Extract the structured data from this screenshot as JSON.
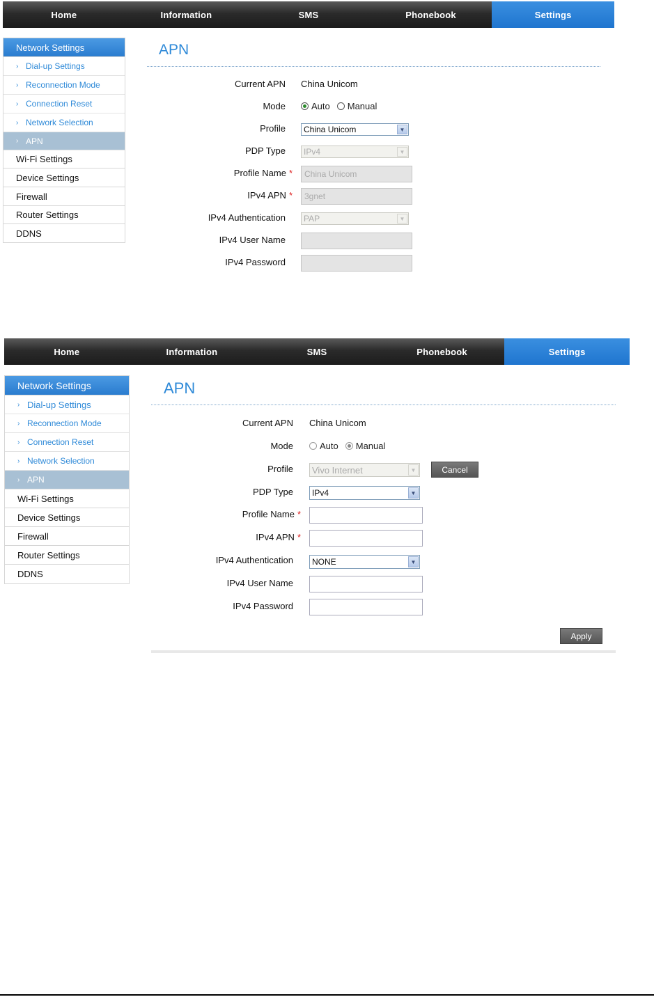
{
  "nav": {
    "tabs": [
      "Home",
      "Information",
      "SMS",
      "Phonebook",
      "Settings"
    ],
    "active": "Settings"
  },
  "sidebar": {
    "header": "Network Settings",
    "subitems": [
      "Dial-up Settings",
      "Reconnection Mode",
      "Connection Reset",
      "Network Selection",
      "APN"
    ],
    "selected": "APN",
    "items": [
      "Wi-Fi Settings",
      "Device Settings",
      "Firewall",
      "Router Settings",
      "DDNS"
    ]
  },
  "screen1": {
    "title": "APN",
    "labels": {
      "current_apn": "Current APN",
      "mode": "Mode",
      "profile": "Profile",
      "pdp_type": "PDP Type",
      "profile_name": "Profile Name",
      "ipv4_apn": "IPv4 APN",
      "ipv4_auth": "IPv4 Authentication",
      "ipv4_user": "IPv4 User Name",
      "ipv4_pass": "IPv4 Password"
    },
    "required_mark": "*",
    "current_apn_value": "China Unicom",
    "mode_options": [
      "Auto",
      "Manual"
    ],
    "mode_selected": "Auto",
    "profile_value": "China Unicom",
    "pdp_type_value": "IPv4",
    "profile_name_value": "China Unicom",
    "ipv4_apn_value": "3gnet",
    "ipv4_auth_value": "PAP",
    "ipv4_user_value": "",
    "ipv4_pass_value": ""
  },
  "screen2": {
    "title": "APN",
    "current_apn_value": "China Unicom",
    "mode_options": [
      "Auto",
      "Manual"
    ],
    "mode_selected": "Manual",
    "profile_value": "Vivo Internet",
    "cancel_label": "Cancel",
    "pdp_type_value": "IPv4",
    "profile_name_value": "",
    "ipv4_apn_value": "",
    "ipv4_auth_value": "NONE",
    "ipv4_user_value": "",
    "ipv4_pass_value": "",
    "apply_label": "Apply"
  },
  "colors": {
    "accent": "#2a7ccf",
    "nav_bg": "#2b2b2b",
    "sidebar_selected": "#a8c0d4",
    "required": "#dd2222"
  }
}
